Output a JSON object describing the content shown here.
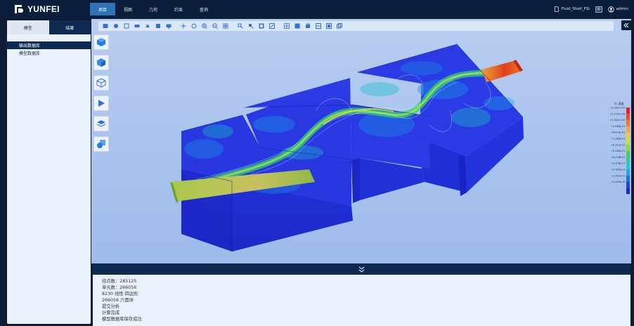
{
  "app": {
    "brand": "YUNFEI",
    "project_file": "Fluid_Shell_FSI",
    "lang_badge": "中",
    "user": "admin"
  },
  "menu": [
    {
      "label": "项目",
      "active": true
    },
    {
      "label": "视图",
      "active": false
    },
    {
      "label": "几何",
      "active": false
    },
    {
      "label": "约束",
      "active": false
    },
    {
      "label": "查询",
      "active": false
    }
  ],
  "left_panel": {
    "tabs": [
      {
        "label": "模型",
        "active": false
      },
      {
        "label": "结果",
        "active": true
      }
    ],
    "tree": [
      {
        "label": "输出数据库",
        "selected": true
      },
      {
        "label": "模型数据库",
        "selected": false
      }
    ]
  },
  "toolbar": {
    "icons": [
      "view-iso-icon",
      "view-front-icon",
      "view-top-icon",
      "view-side-icon",
      "view-back-icon",
      "view-bottom-icon",
      "view-screen-icon",
      "pan-icon",
      "rotate-icon",
      "zoom-in-icon",
      "zoom-out-icon",
      "fit-view-icon",
      "select-node-icon",
      "select-element-icon",
      "select-face-icon",
      "select-box-icon",
      "mesh-icon",
      "display-icon",
      "layer-icon",
      "section-icon",
      "clip-icon",
      "copy-view-icon"
    ]
  },
  "side_tools": [
    "solid-display-icon",
    "shaded-display-icon",
    "wireframe-display-icon",
    "pointer-icon",
    "layers-icon",
    "transparent-icon"
  ],
  "legend": {
    "header": "U, 速度",
    "colors": [
      "#e8202a",
      "#ee4a24",
      "#f3762a",
      "#f7a23a",
      "#f2cb3c",
      "#c8e035",
      "#8fd83a",
      "#4ccf4b",
      "#2ccf8a",
      "#20cdc7",
      "#1ea8e8",
      "#1c75e0",
      "#1d45d8",
      "#2424c8"
    ],
    "labels": [
      "+1.262e+00",
      "+1.157e+00",
      "+1.052e+00",
      "+9.468e-01",
      "+8.416e-01",
      "+7.364e-01",
      "+6.312e-01",
      "+5.260e-01",
      "+4.208e-01",
      "+3.156e-01",
      "+2.104e-01",
      "+1.052e-01",
      "+1.000e-10"
    ]
  },
  "console": {
    "lines": [
      "结点数：285125",
      "单元数：266056",
      "8230 线性 四边形",
      "266056 六面体",
      "提交分析",
      "计算完成",
      "模型数据库保存成功"
    ]
  },
  "colors": {
    "topbar": "#0b1f3d",
    "accent": "#2f73b7",
    "panel": "#e9f1fb",
    "dark_tab": "#0e2a52"
  }
}
